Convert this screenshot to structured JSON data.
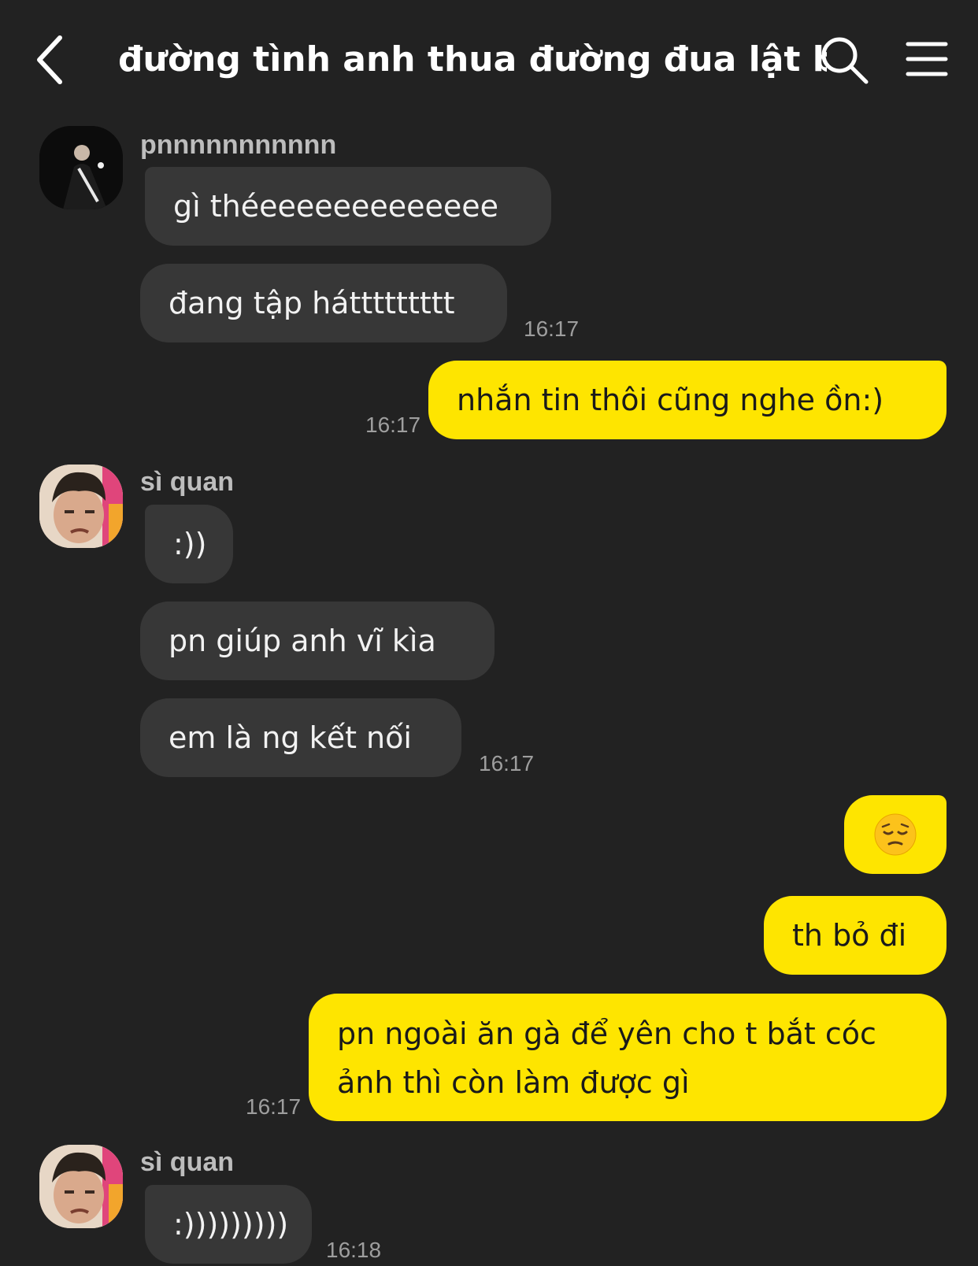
{
  "header": {
    "title": "đường tình anh thua đường đua lật bá",
    "back_icon": "chevron-left-icon",
    "search_icon": "search-icon",
    "menu_icon": "hamburger-menu-icon"
  },
  "colors": {
    "background": "#222222",
    "incoming_bubble": "#373737",
    "outgoing_bubble": "#fee500",
    "timestamp": "#9e9e9e"
  },
  "messages": {
    "g1": {
      "sender": "pnnnnnnnnnnn",
      "m1": "gì théeeeeeeeeeeeee",
      "m2": "đang tập háttttttttt",
      "time": "16:17"
    },
    "me1": {
      "m1": "nhắn tin thôi cũng nghe ồn:)",
      "time": "16:17"
    },
    "g2": {
      "sender": "sì quan",
      "m1": ":))",
      "m2": "pn giúp anh vĩ kìa",
      "m3": "em là ng kết nối",
      "time": "16:17"
    },
    "me2": {
      "m1_emoji": "pensive-face-emoji",
      "m2": "th bỏ đi",
      "m3": "pn ngoài ăn gà để yên cho t bắt cóc ảnh thì còn làm được gì",
      "time": "16:17"
    },
    "g3": {
      "sender": "sì quan",
      "m1": ":)))))))))",
      "time": "16:18"
    }
  }
}
